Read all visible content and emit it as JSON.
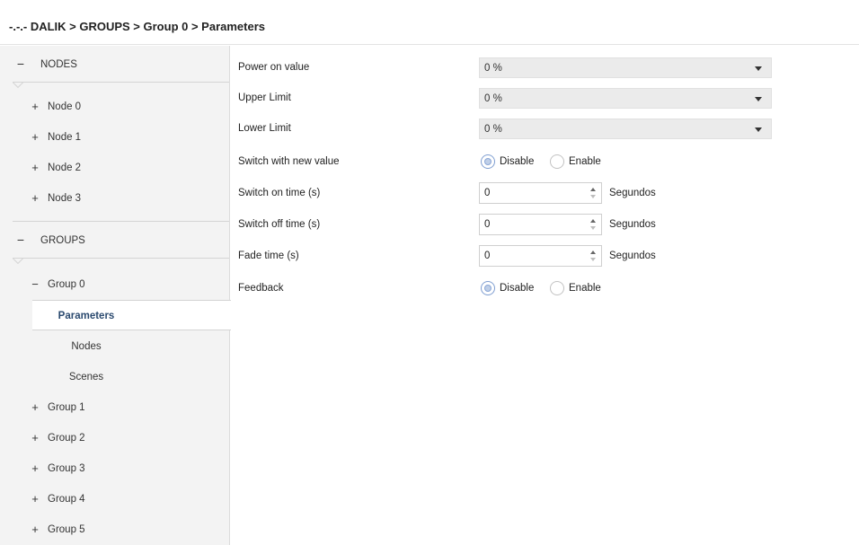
{
  "breadcrumb": "-.-.- DALIK > GROUPS > Group 0 > Parameters",
  "sidebar": {
    "nodes_section": {
      "symbol": "−",
      "label": "NODES"
    },
    "nodes": [
      {
        "symbol": "+",
        "label": "Node 0"
      },
      {
        "symbol": "+",
        "label": "Node 1"
      },
      {
        "symbol": "+",
        "label": "Node 2"
      },
      {
        "symbol": "+",
        "label": "Node 3"
      }
    ],
    "groups_section": {
      "symbol": "−",
      "label": "GROUPS"
    },
    "group0": {
      "symbol": "−",
      "label": "Group 0"
    },
    "group0_children": [
      {
        "label": "Parameters",
        "active": true
      },
      {
        "label": "Nodes"
      },
      {
        "label": "Scenes"
      }
    ],
    "groups": [
      {
        "symbol": "+",
        "label": "Group 1"
      },
      {
        "symbol": "+",
        "label": "Group 2"
      },
      {
        "symbol": "+",
        "label": "Group 3"
      },
      {
        "symbol": "+",
        "label": "Group 4"
      },
      {
        "symbol": "+",
        "label": "Group 5"
      }
    ]
  },
  "params": {
    "power_on": {
      "label": "Power on value",
      "value": "0 %"
    },
    "upper_limit": {
      "label": "Upper Limit",
      "value": "0 %"
    },
    "lower_limit": {
      "label": "Lower Limit",
      "value": "0 %"
    },
    "switch_new": {
      "label": "Switch with new value",
      "opt1": "Disable",
      "opt2": "Enable",
      "selected": "Disable"
    },
    "switch_on": {
      "label": "Switch on time (s)",
      "value": "0",
      "unit": "Segundos"
    },
    "switch_off": {
      "label": "Switch off time (s)",
      "value": "0",
      "unit": "Segundos"
    },
    "fade": {
      "label": "Fade time (s)",
      "value": "0",
      "unit": "Segundos"
    },
    "feedback": {
      "label": "Feedback",
      "opt1": "Disable",
      "opt2": "Enable",
      "selected": "Disable"
    }
  }
}
